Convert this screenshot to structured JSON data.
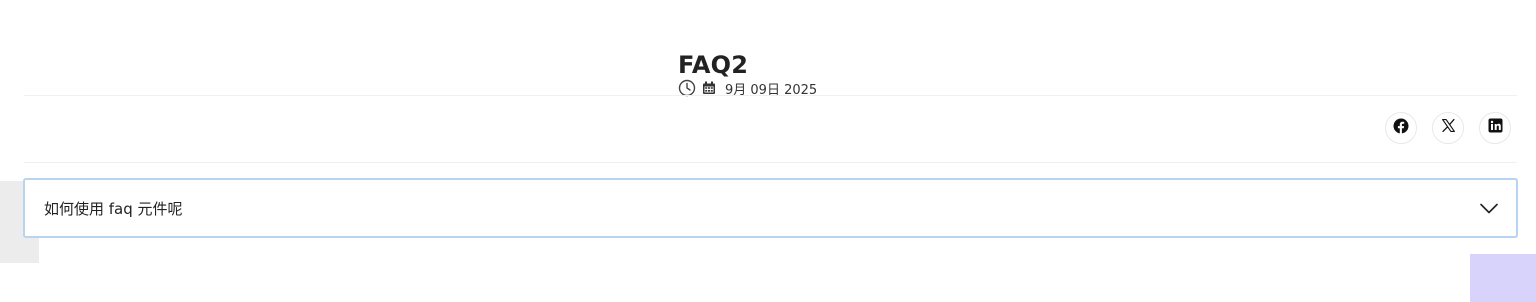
{
  "post": {
    "title": "FAQ2",
    "date": "9月 09日 2025",
    "meta_icons": [
      "clock-icon",
      "calendar-icon"
    ]
  },
  "share": {
    "buttons": [
      {
        "name": "facebook",
        "icon": "facebook-icon"
      },
      {
        "name": "x",
        "icon": "x-icon"
      },
      {
        "name": "linkedin",
        "icon": "linkedin-icon"
      }
    ]
  },
  "faq": {
    "items": [
      {
        "question": "如何使用 faq 元件呢",
        "expanded": false,
        "icon": "chevron-down-icon"
      }
    ]
  },
  "colors": {
    "text": "#222222",
    "focus_border": "#b9d3f3",
    "divider": "#f0f0f0",
    "side_block_gray": "#ececec",
    "corner_block_purple": "#d7d3fb"
  }
}
